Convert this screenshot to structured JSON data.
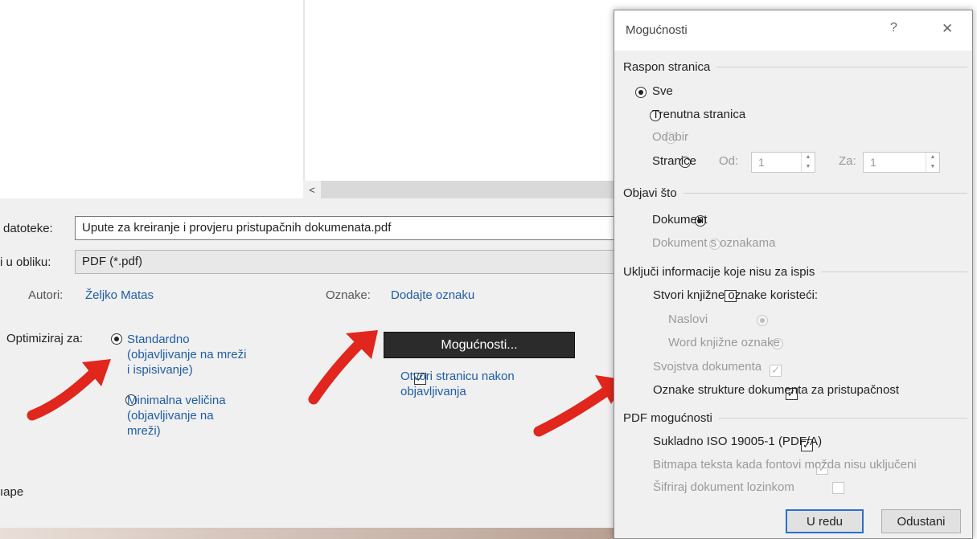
{
  "save": {
    "filename_label": "datoteke:",
    "filename_value": "Upute za kreiranje i provjeru pristupačnih dokumenata.pdf",
    "type_label": "i u obliku:",
    "type_value": "PDF (*.pdf)",
    "authors_label": "Autori:",
    "authors_value": "Željko Matas",
    "tags_label": "Oznake:",
    "tags_value": "Dodajte oznaku",
    "optimize_label": "Optimiziraj za:",
    "opt_standard_line1": "Standardno",
    "opt_standard_line2": "(objavljivanje na mreži",
    "opt_standard_line3": "i ispisivanje)",
    "opt_min_line1": "Minimalna veličina",
    "opt_min_line2": "(objavljivanje na",
    "opt_min_line3": "mreži)",
    "options_button": "Mogućnosti...",
    "open_after_line1": "Otvori stranicu nakon",
    "open_after_line2": "objavljivanja",
    "hide_folders_partial": "ıape",
    "scroll_left_glyph": "<"
  },
  "dialog": {
    "title": "Mogućnosti",
    "help_glyph": "?",
    "close_glyph": "✕",
    "page_range": {
      "heading": "Raspon stranica",
      "all": "Sve",
      "current": "Trenutna stranica",
      "selection": "Odabir",
      "pages": "Stranice",
      "from_label": "Od:",
      "from_value": "1",
      "to_label": "Za:",
      "to_value": "1"
    },
    "publish_what": {
      "heading": "Objavi što",
      "document": "Dokument",
      "document_markup": "Dokument s oznakama"
    },
    "non_print": {
      "heading": "Uključi informacije koje nisu za ispis",
      "create_bookmarks": "Stvori knjižne oznake koristeći:",
      "headings": "Naslovi",
      "word_bookmarks": "Word knjižne oznake",
      "doc_properties": "Svojstva dokumenta",
      "structure_tags": "Oznake strukture dokumenta za pristupačnost"
    },
    "pdf_options": {
      "heading": "PDF mogućnosti",
      "iso": "Sukladno ISO 19005-1 (PDF/A)",
      "bitmap": "Bitmapa teksta kada fontovi možda nisu uključeni",
      "encrypt": "Šifriraj dokument lozinkom"
    },
    "ok_button": "U redu",
    "cancel_button": "Odustani"
  },
  "colors": {
    "link": "#1e5ca8",
    "dark_button": "#2b2b2b",
    "arrow": "#e0261d",
    "default_border": "#2a6fcf"
  },
  "icons": [
    "radio-icon",
    "checkbox-icon",
    "spin-up-icon",
    "spin-down-icon",
    "help-icon",
    "close-icon",
    "red-arrow-icon"
  ]
}
